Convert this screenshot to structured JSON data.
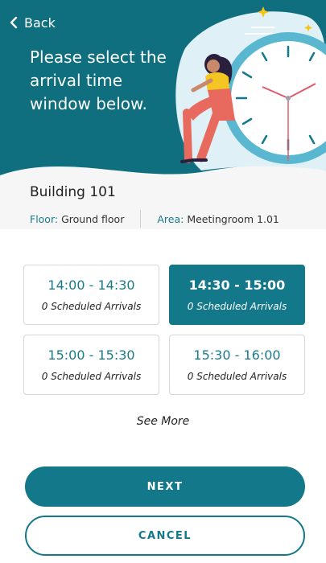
{
  "colors": {
    "primary": "#12788a",
    "hero_bg": "#0f6f7f",
    "accent_label": "#1a7a89"
  },
  "header": {
    "back_label": "Back",
    "back_icon": "chevron-left-icon",
    "title": "Please select the arrival time window below."
  },
  "location": {
    "building": "Building 101",
    "floor_key": "Floor:",
    "floor_value": "Ground floor",
    "area_key": "Area:",
    "area_value": "Meetingroom 1.01"
  },
  "slots": [
    {
      "time": "14:00 - 14:30",
      "count": "0 Scheduled Arrivals",
      "selected": false
    },
    {
      "time": "14:30 - 15:00",
      "count": "0 Scheduled Arrivals",
      "selected": true
    },
    {
      "time": "15:00 - 15:30",
      "count": "0 Scheduled Arrivals",
      "selected": false
    },
    {
      "time": "15:30 - 16:00",
      "count": "0 Scheduled Arrivals",
      "selected": false
    }
  ],
  "see_more_label": "See More",
  "actions": {
    "next_label": "NEXT",
    "cancel_label": "CANCEL"
  }
}
